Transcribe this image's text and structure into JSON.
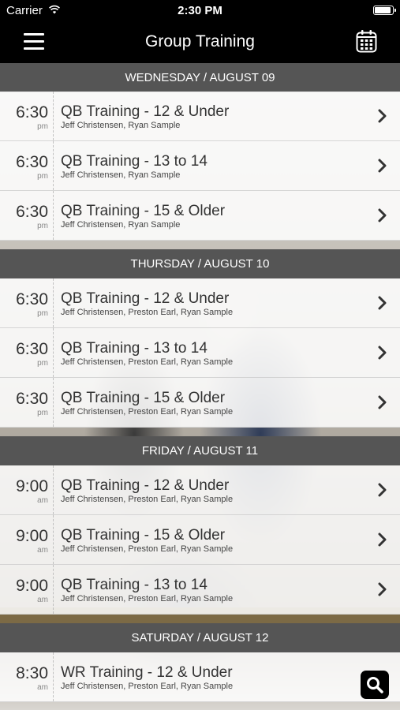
{
  "status_bar": {
    "carrier": "Carrier",
    "time": "2:30 PM"
  },
  "nav": {
    "title": "Group Training"
  },
  "sections": [
    {
      "header": "WEDNESDAY / AUGUST 09",
      "sessions": [
        {
          "time": "6:30",
          "ampm": "pm",
          "title": "QB Training - 12 & Under",
          "coaches": "Jeff Christensen, Ryan Sample"
        },
        {
          "time": "6:30",
          "ampm": "pm",
          "title": "QB Training - 13 to 14",
          "coaches": "Jeff Christensen, Ryan Sample"
        },
        {
          "time": "6:30",
          "ampm": "pm",
          "title": "QB Training - 15 & Older",
          "coaches": "Jeff Christensen, Ryan Sample"
        }
      ]
    },
    {
      "header": "THURSDAY / AUGUST 10",
      "sessions": [
        {
          "time": "6:30",
          "ampm": "pm",
          "title": "QB Training - 12 & Under",
          "coaches": "Jeff Christensen, Preston Earl, Ryan Sample"
        },
        {
          "time": "6:30",
          "ampm": "pm",
          "title": "QB Training - 13 to 14",
          "coaches": "Jeff Christensen, Preston Earl, Ryan Sample"
        },
        {
          "time": "6:30",
          "ampm": "pm",
          "title": "QB Training - 15 & Older",
          "coaches": "Jeff Christensen, Preston Earl, Ryan Sample"
        }
      ]
    },
    {
      "header": "FRIDAY / AUGUST 11",
      "sessions": [
        {
          "time": "9:00",
          "ampm": "am",
          "title": "QB Training - 12 & Under",
          "coaches": "Jeff Christensen, Preston Earl, Ryan Sample"
        },
        {
          "time": "9:00",
          "ampm": "am",
          "title": "QB Training - 15 & Older",
          "coaches": "Jeff Christensen, Preston Earl, Ryan Sample"
        },
        {
          "time": "9:00",
          "ampm": "am",
          "title": "QB Training - 13 to 14",
          "coaches": "Jeff Christensen, Preston Earl, Ryan Sample"
        }
      ]
    },
    {
      "header": "SATURDAY / AUGUST 12",
      "sessions": [
        {
          "time": "8:30",
          "ampm": "am",
          "title": "WR Training - 12 & Under",
          "coaches": "Jeff Christensen, Preston Earl, Ryan Sample"
        }
      ]
    }
  ],
  "icons": {
    "menu": "hamburger-menu-icon",
    "calendar": "calendar-icon",
    "chevron": "chevron-right-icon",
    "search": "search-icon",
    "wifi": "wifi-icon",
    "battery": "battery-icon"
  },
  "colors": {
    "bar_bg": "#000000",
    "section_header_bg": "#555555",
    "row_bg": "rgba(255,255,255,0.86)"
  }
}
